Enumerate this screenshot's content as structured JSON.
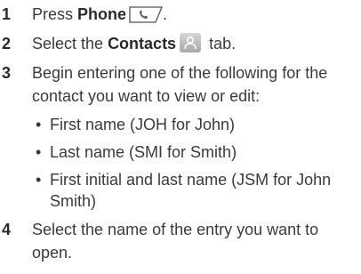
{
  "steps": [
    {
      "number": "1",
      "pre": "Press ",
      "bold": "Phone",
      "post": "."
    },
    {
      "number": "2",
      "pre": "Select the ",
      "bold": "Contacts",
      "post": " tab."
    },
    {
      "number": "3",
      "text": "Begin entering one of the following for the contact you want to view or edit:",
      "bullets": [
        "First name (JOH for John)",
        "Last name (SMI for Smith)",
        "First initial and last name (JSM for John Smith)"
      ]
    },
    {
      "number": "4",
      "text": "Select the name of the entry you want to open."
    }
  ],
  "bullet_char": "•",
  "icons": {
    "phone": "phone-key-icon",
    "contacts": "contacts-tab-icon"
  },
  "colors": {
    "text": "#3a3a3a",
    "icon_tab_gradient_top": "#d6d6d6",
    "icon_tab_gradient_bottom": "#a9a9a9"
  }
}
